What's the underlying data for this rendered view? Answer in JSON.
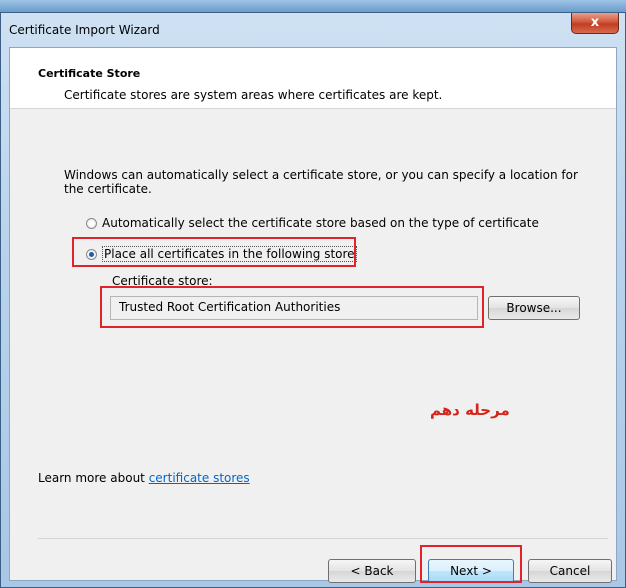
{
  "window": {
    "title": "Certificate Import Wizard",
    "close_glyph": "x"
  },
  "header": {
    "title": "Certificate Store",
    "subtitle": "Certificate stores are system areas where certificates are kept."
  },
  "body": {
    "description": "Windows can automatically select a certificate store, or you can specify a location for the certificate.",
    "radio_auto_label": "Automatically select the certificate store based on the type of certificate",
    "radio_place_label": "Place all certificates in the following store",
    "selected_option": "Place all certificates in the following store",
    "store_label": "Certificate store:",
    "store_value": "Trusted Root Certification Authorities",
    "browse_label": "Browse...",
    "annotation": "مرحله دهم",
    "learn_prefix": "Learn more about ",
    "learn_link": "certificate stores"
  },
  "footer": {
    "back_label": "< Back",
    "next_label": "Next >",
    "cancel_label": "Cancel"
  },
  "colors": {
    "highlight": "#e0242c",
    "link": "#0066cc",
    "annotation": "#d4251c"
  }
}
